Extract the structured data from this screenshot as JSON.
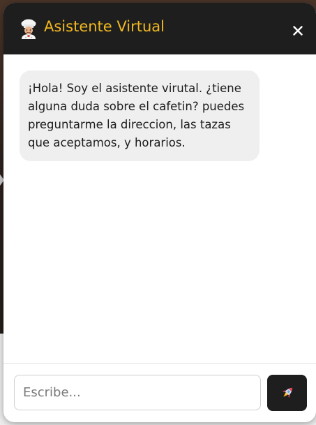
{
  "header": {
    "title": "Asistente Virtual",
    "chef_icon": "chef-icon",
    "close_icon": "close-icon"
  },
  "messages": [
    {
      "sender": "bot",
      "text": "¡Hola! Soy el asistente virutal. ¿tiene alguna duda sobre el cafetin? puedes preguntarme la direccion, las tazas que aceptamos, y horarios."
    }
  ],
  "composer": {
    "placeholder": "Escribe...",
    "value": "",
    "send_icon": "rocket-icon"
  },
  "colors": {
    "header_bg": "#1e1e1e",
    "title": "#f1b820",
    "bubble_bg": "#efefef",
    "send_bg": "#1e1e1e"
  }
}
